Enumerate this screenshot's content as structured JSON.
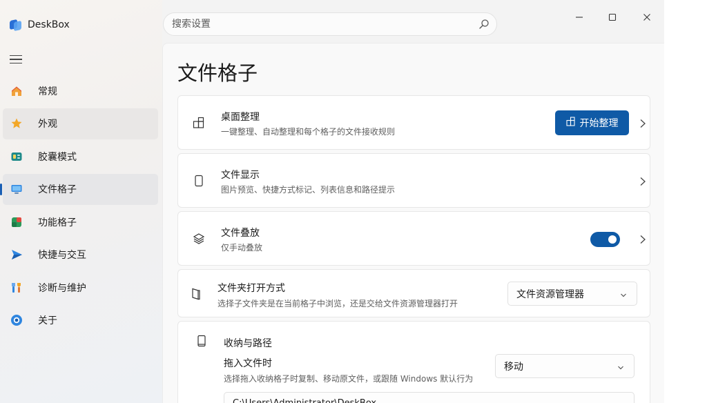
{
  "app": {
    "name": "DeskBox"
  },
  "search": {
    "placeholder": "搜索设置"
  },
  "nav": {
    "items": [
      {
        "label": "常规"
      },
      {
        "label": "外观"
      },
      {
        "label": "胶囊模式"
      },
      {
        "label": "文件格子"
      },
      {
        "label": "功能格子"
      },
      {
        "label": "快捷与交互"
      },
      {
        "label": "诊断与维护"
      },
      {
        "label": "关于"
      }
    ],
    "active": "文件格子"
  },
  "page": {
    "title": "文件格子"
  },
  "cards": {
    "desktop_organize": {
      "title": "桌面整理",
      "desc": "一键整理、自动整理和每个格子的文件接收规则",
      "button": "开始整理"
    },
    "file_display": {
      "title": "文件显示",
      "desc": "图片预览、快捷方式标记、列表信息和路径提示"
    },
    "file_stack": {
      "title": "文件叠放",
      "desc": "仅手动叠放",
      "toggle_on": true
    },
    "folder_open": {
      "title": "文件夹打开方式",
      "desc": "选择子文件夹是在当前格子中浏览，还是交给文件资源管理器打开",
      "selected": "文件资源管理器"
    },
    "storage_path": {
      "title": "收纳与路径",
      "drag_title": "拖入文件时",
      "drag_desc": "选择拖入收纳格子时复制、移动原文件，或跟随 Windows 默认行为",
      "drag_selected": "移动",
      "path_value": "C:\\Users\\Administrator\\DeskBox"
    }
  },
  "colors": {
    "accent": "#0f5aa6",
    "sidebar_bg": "#f2f0ee",
    "content_bg": "#f9f9f9"
  }
}
